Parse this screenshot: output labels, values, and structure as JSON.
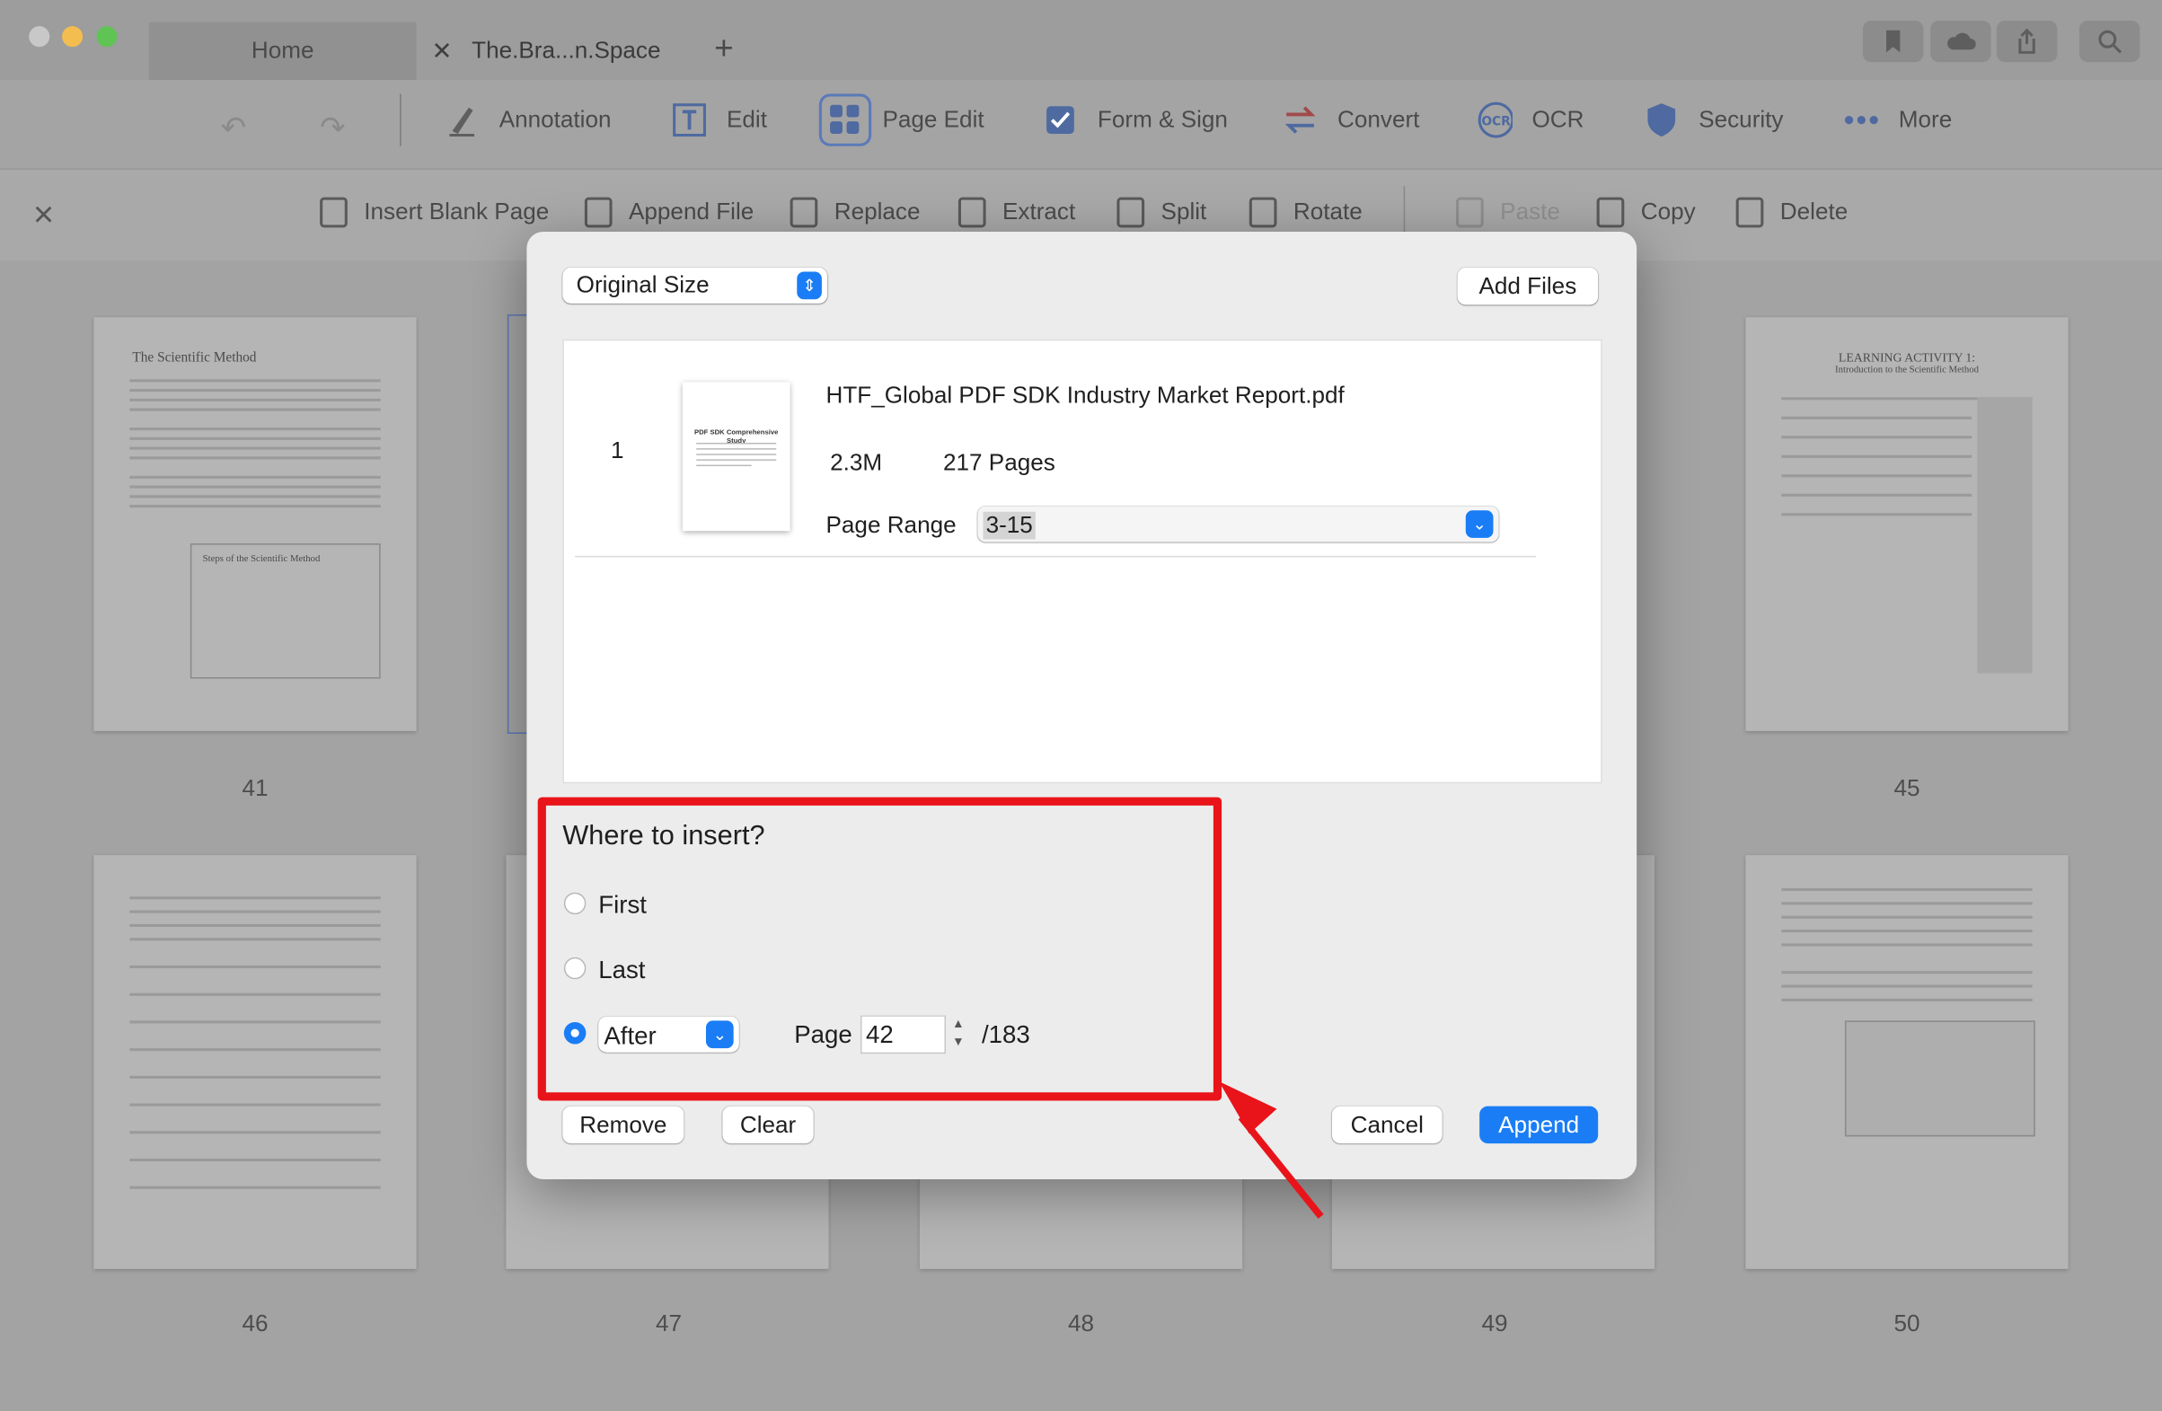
{
  "window": {
    "tabs": [
      {
        "label": "Home"
      },
      {
        "label": "The.Bra...n.Space"
      }
    ],
    "new_tab_label": "+"
  },
  "toolbar": {
    "items": [
      {
        "label": "Annotation",
        "icon": "highlighter-icon"
      },
      {
        "label": "Edit",
        "icon": "text-edit-icon"
      },
      {
        "label": "Page Edit",
        "icon": "page-grid-icon"
      },
      {
        "label": "Form & Sign",
        "icon": "checkbox-icon"
      },
      {
        "label": "Convert",
        "icon": "convert-icon"
      },
      {
        "label": "OCR",
        "icon": "ocr-icon"
      },
      {
        "label": "Security",
        "icon": "shield-icon"
      },
      {
        "label": "More",
        "icon": "more-icon"
      }
    ]
  },
  "subbar": {
    "close_label": "×",
    "items": [
      {
        "label": "Insert Blank Page"
      },
      {
        "label": "Append File"
      },
      {
        "label": "Replace"
      },
      {
        "label": "Extract"
      },
      {
        "label": "Split"
      },
      {
        "label": "Rotate"
      },
      {
        "label": "Paste"
      },
      {
        "label": "Copy"
      },
      {
        "label": "Delete"
      }
    ]
  },
  "thumbnails": {
    "page_numbers": [
      "41",
      "45",
      "46",
      "47",
      "48",
      "49",
      "50"
    ],
    "left_title": "The Scientific Method",
    "right_title": "LEARNING ACTIVITY 1:",
    "right_subtitle": "Introduction to the Scientific Method",
    "box_title": "Steps of the Scientific Method"
  },
  "dialog": {
    "size_select": "Original Size",
    "add_files": "Add Files",
    "file": {
      "index": "1",
      "thumb_title": "PDF SDK Comprehensive Study",
      "name": "HTF_Global PDF SDK Industry Market Report.pdf",
      "size": "2.3M",
      "pages": "217 Pages",
      "range_label": "Page Range",
      "range_value": "3-15"
    },
    "insert": {
      "title": "Where to insert?",
      "first": "First",
      "last": "Last",
      "after": "After",
      "page_label": "Page",
      "page_value": "42",
      "total": "/183",
      "selected": "after"
    },
    "remove": "Remove",
    "clear": "Clear",
    "cancel": "Cancel",
    "append": "Append"
  },
  "colors": {
    "accent": "#1a7df5",
    "highlight": "#e8141a"
  }
}
